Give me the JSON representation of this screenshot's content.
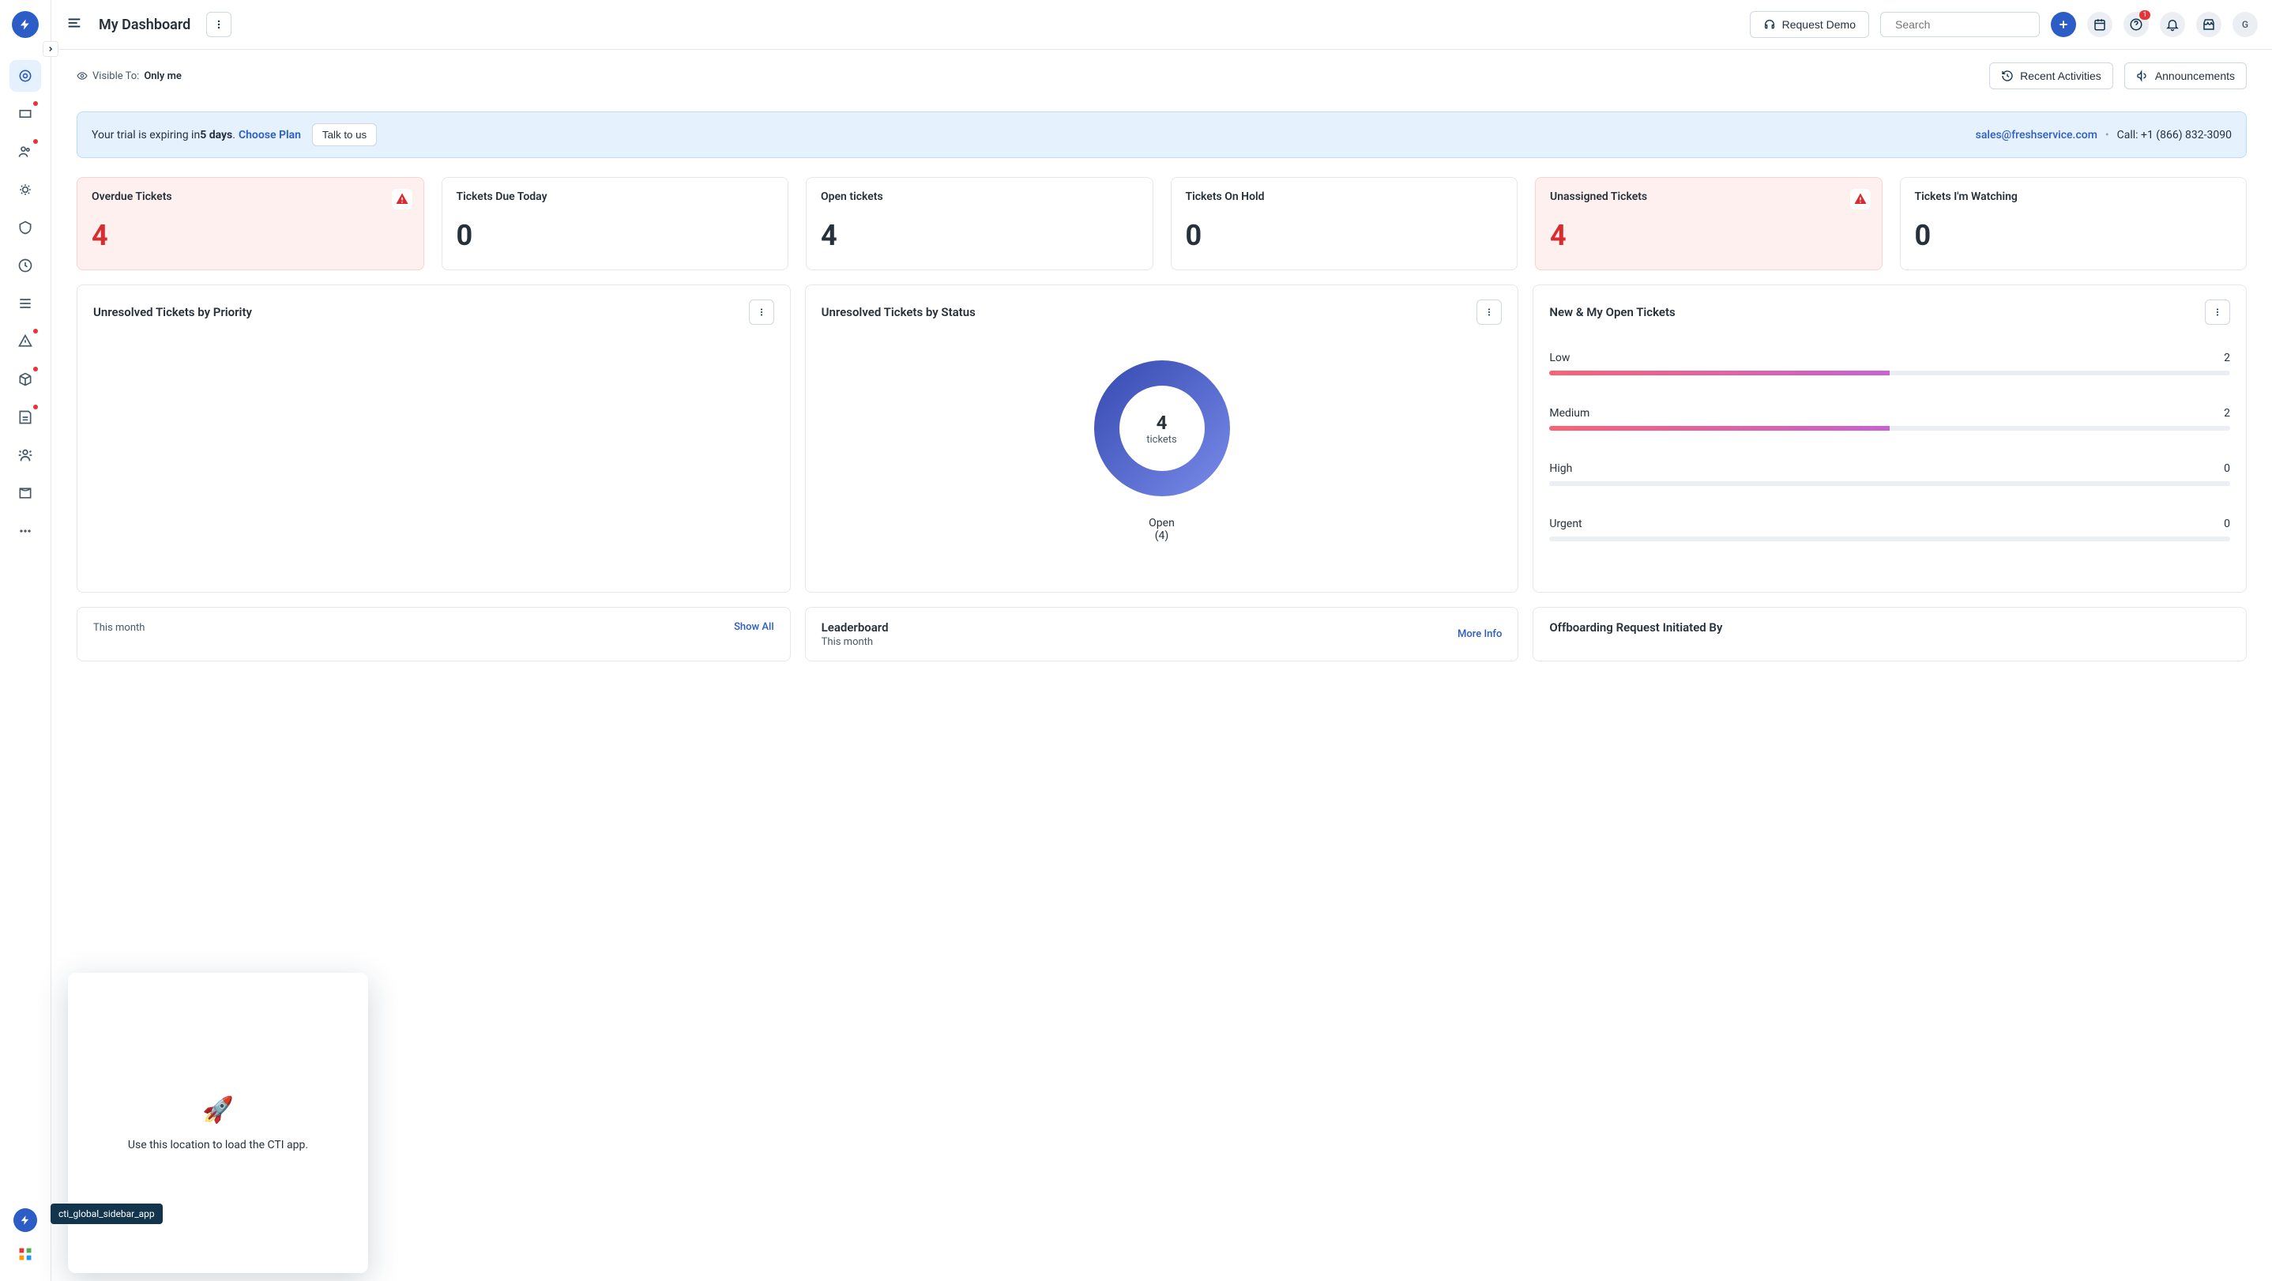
{
  "header": {
    "title": "My Dashboard",
    "request_demo": "Request Demo",
    "search_placeholder": "Search",
    "help_badge": "1",
    "avatar_initial": "G"
  },
  "subheader": {
    "visible_label": "Visible To:",
    "visible_value": "Only me",
    "recent_activities": "Recent Activities",
    "announcements": "Announcements"
  },
  "banner": {
    "prefix": "Your trial is expiring in ",
    "days": "5 days",
    "suffix": ". ",
    "choose_plan": "Choose Plan",
    "talk": "Talk to us",
    "email": "sales@freshservice.com",
    "call": "Call: +1 (866) 832-3090"
  },
  "stats": [
    {
      "label": "Overdue Tickets",
      "value": "4",
      "alert": true
    },
    {
      "label": "Tickets Due Today",
      "value": "0",
      "alert": false
    },
    {
      "label": "Open tickets",
      "value": "4",
      "alert": false
    },
    {
      "label": "Tickets On Hold",
      "value": "0",
      "alert": false
    },
    {
      "label": "Unassigned Tickets",
      "value": "4",
      "alert": true
    },
    {
      "label": "Tickets I'm Watching",
      "value": "0",
      "alert": false
    }
  ],
  "widget1": {
    "title": "Unresolved Tickets by Priority"
  },
  "widget2": {
    "title": "Unresolved Tickets by Status",
    "center_num": "4",
    "center_label": "tickets",
    "legend": "Open\n(4)"
  },
  "widget3": {
    "title": "New & My Open Tickets",
    "rows": [
      {
        "label": "Low",
        "value": "2",
        "pct": 50
      },
      {
        "label": "Medium",
        "value": "2",
        "pct": 50
      },
      {
        "label": "High",
        "value": "0",
        "pct": 0
      },
      {
        "label": "Urgent",
        "value": "0",
        "pct": 0
      }
    ]
  },
  "widget4": {
    "sub": "This month",
    "link": "Show All"
  },
  "widget5": {
    "title": "Leaderboard",
    "sub": "This month",
    "link": "More Info"
  },
  "widget6": {
    "title": "Offboarding Request Initiated By"
  },
  "popup": {
    "text": "Use this location to load the CTI app."
  },
  "tooltip": "cti_global_sidebar_app",
  "chart_data": [
    {
      "type": "pie",
      "title": "Unresolved Tickets by Status",
      "series": [
        {
          "name": "Open",
          "value": 4
        }
      ],
      "total_label": "tickets",
      "total": 4
    },
    {
      "type": "bar",
      "title": "New & My Open Tickets",
      "categories": [
        "Low",
        "Medium",
        "High",
        "Urgent"
      ],
      "values": [
        2,
        2,
        0,
        0
      ]
    }
  ]
}
